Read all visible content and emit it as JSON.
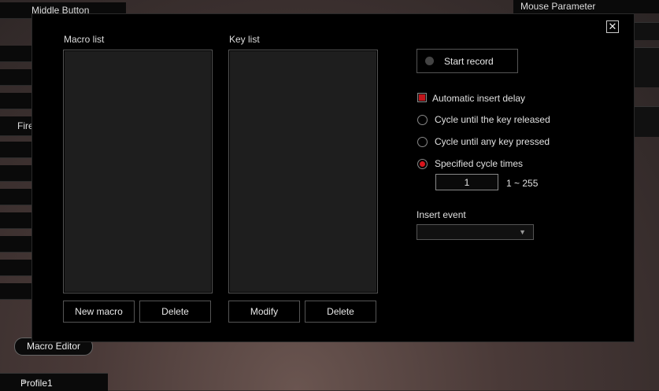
{
  "background": {
    "top_left_label": "Middle Button",
    "side_label": "Fire",
    "mouse_parameter": "Mouse Parameter",
    "macro_editor": "Macro Editor",
    "profile": "Profile1"
  },
  "dialog": {
    "close_glyph": "✕",
    "macro_list_label": "Macro list",
    "key_list_label": "Key list",
    "new_macro": "New macro",
    "delete_macro": "Delete",
    "modify": "Modify",
    "delete_key": "Delete",
    "start_record": "Start record",
    "auto_insert_delay": "Automatic insert delay",
    "auto_insert_delay_checked": true,
    "options": [
      {
        "label": "Cycle until the key released",
        "selected": false
      },
      {
        "label": "Cycle until any key pressed",
        "selected": false
      },
      {
        "label": "Specified cycle times",
        "selected": true
      }
    ],
    "cycle_value": "1",
    "cycle_range": "1 ~ 255",
    "insert_event_label": "Insert event",
    "insert_event_value": ""
  },
  "colors": {
    "accent": "#d8141c",
    "dialog_bg": "#000000",
    "list_bg": "#1e1e1e"
  }
}
